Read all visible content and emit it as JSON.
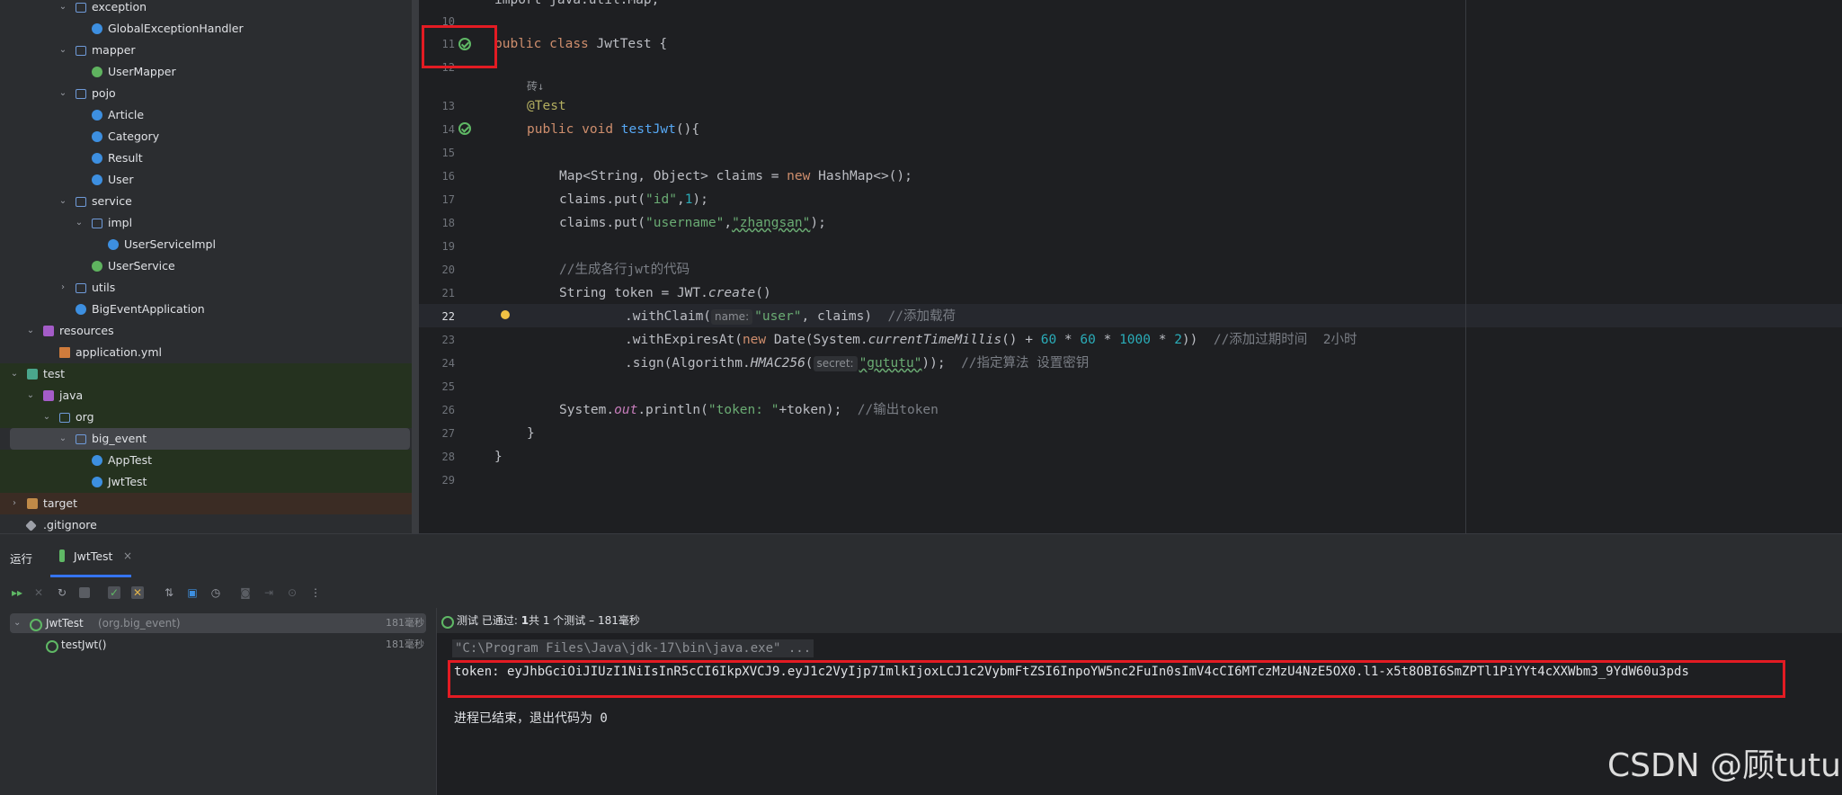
{
  "project_tree": [
    {
      "label": "exception",
      "icon": "package-folder-icon",
      "depth": 4,
      "expanded": true
    },
    {
      "label": "GlobalExceptionHandler",
      "icon": "class-icon",
      "depth": 5
    },
    {
      "label": "mapper",
      "icon": "package-folder-icon",
      "depth": 4,
      "expanded": true
    },
    {
      "label": "UserMapper",
      "icon": "interface-icon",
      "depth": 5
    },
    {
      "label": "pojo",
      "icon": "package-folder-icon",
      "depth": 4,
      "expanded": true
    },
    {
      "label": "Article",
      "icon": "class-icon",
      "depth": 5
    },
    {
      "label": "Category",
      "icon": "class-icon",
      "depth": 5
    },
    {
      "label": "Result",
      "icon": "class-icon",
      "depth": 5
    },
    {
      "label": "User",
      "icon": "class-icon",
      "depth": 5
    },
    {
      "label": "service",
      "icon": "package-folder-icon",
      "depth": 4,
      "expanded": true
    },
    {
      "label": "impl",
      "icon": "package-folder-icon",
      "depth": 5,
      "expanded": true
    },
    {
      "label": "UserServiceImpl",
      "icon": "class-icon",
      "depth": 6
    },
    {
      "label": "UserService",
      "icon": "interface-icon",
      "depth": 5
    },
    {
      "label": "utils",
      "icon": "package-folder-icon",
      "depth": 4,
      "expanded": false
    },
    {
      "label": "BigEventApplication",
      "icon": "class-icon",
      "depth": 4
    },
    {
      "label": "resources",
      "icon": "resources-folder-icon",
      "depth": 2,
      "expanded": true
    },
    {
      "label": "application.yml",
      "icon": "yml-file-icon",
      "depth": 3
    },
    {
      "label": "test",
      "icon": "test-folder-icon",
      "depth": 1,
      "expanded": true,
      "style": "green"
    },
    {
      "label": "java",
      "icon": "test-source-folder-icon",
      "depth": 2,
      "expanded": true,
      "style": "green"
    },
    {
      "label": "org",
      "icon": "package-folder-icon",
      "depth": 3,
      "expanded": true,
      "style": "green"
    },
    {
      "label": "big_event",
      "icon": "package-folder-icon",
      "depth": 4,
      "expanded": true,
      "style": "selected"
    },
    {
      "label": "AppTest",
      "icon": "test-class-icon",
      "depth": 5,
      "style": "green"
    },
    {
      "label": "JwtTest",
      "icon": "test-class-icon",
      "depth": 5,
      "style": "green"
    },
    {
      "label": "target",
      "icon": "target-folder-icon",
      "depth": 1,
      "expanded": false,
      "style": "orange"
    },
    {
      "label": ".gitignore",
      "icon": "git-file-icon",
      "depth": 1
    }
  ],
  "editor": {
    "line_numbers": [
      "10",
      "11",
      "12",
      "",
      "13",
      "14",
      "15",
      "16",
      "17",
      "18",
      "19",
      "20",
      "21",
      "22",
      "23",
      "24",
      "25",
      "26",
      "27",
      "28",
      "29"
    ],
    "top_cut_line": "import java.util.Map;",
    "author_hint": "砖↓",
    "code": {
      "l11_kw1": "public",
      "l11_kw2": "class",
      "l11_rest": " JwtTest {",
      "l13": "@Test",
      "l14_kw1": "public",
      "l14_kw2": "void",
      "l14_fn": "testJwt",
      "l14_rest": "(){",
      "l16_a": "Map<String, Object> claims = ",
      "l16_kw": "new",
      "l16_b": " HashMap<>();",
      "l17_a": "claims.put(",
      "l17_s": "\"id\"",
      "l17_c": ",",
      "l17_n": "1",
      "l17_d": ");",
      "l18_a": "claims.put(",
      "l18_s1": "\"username\"",
      "l18_c": ",",
      "l18_s2": "\"zhangsan\"",
      "l18_d": ");",
      "l20": "//生成各行jwt的代码",
      "l21_a": "String token = JWT.",
      "l21_it": "create",
      "l21_b": "()",
      "l22_a": ".withClaim(",
      "l22_hint": "name:",
      "l22_s": "\"user\"",
      "l22_b": ", claims)  ",
      "l22_cm": "//添加载荷",
      "l23_a": ".withExpiresAt(",
      "l23_kw": "new",
      "l23_b": " Date(System.",
      "l23_it": "currentTimeMillis",
      "l23_c": "() + ",
      "l23_n1": "60",
      "l23_op1": " * ",
      "l23_n2": "60",
      "l23_op2": " * ",
      "l23_n3": "1000",
      "l23_op3": " * ",
      "l23_n4": "2",
      "l23_d": "))  ",
      "l23_cm": "//添加过期时间  2小时",
      "l24_a": ".sign(Algorithm.",
      "l24_it": "HMAC256",
      "l24_b": "(",
      "l24_hint": "secret:",
      "l24_s": "\"gututu\"",
      "l24_c": "));  ",
      "l24_cm": "//指定算法 设置密钥",
      "l26_a": "System.",
      "l26_st": "out",
      "l26_b": ".println(",
      "l26_s": "\"token: \"",
      "l26_c": "+token);  ",
      "l26_cm": "//输出token",
      "l27": "}",
      "l28": "}"
    }
  },
  "run_panel": {
    "title": "运行",
    "tab_label": "JwtTest",
    "tests": [
      {
        "name": "JwtTest",
        "pkg": "(org.big_event)",
        "time": "181毫秒"
      },
      {
        "name": "testJwt()",
        "time": "181毫秒"
      }
    ],
    "status_prefix": "测试 已通过: ",
    "status_count": "1",
    "status_suffix": "共 1 个测试 – 181毫秒",
    "console": {
      "cmd": "\"C:\\Program Files\\Java\\jdk-17\\bin\\java.exe\" ...",
      "token": "token: eyJhbGciOiJIUzI1NiIsInR5cCI6IkpXVCJ9.eyJ1c2VyIjp7ImlkIjoxLCJ1c2VybmFtZSI6InpoYW5nc2FuIn0sImV4cCI6MTczMzU4NzE5OX0.l1-x5t8OBI6SmZPTl1PiYYt4cXXWbm3_9YdW60u3pds",
      "exit": "进程已结束，退出代码为 0"
    }
  },
  "watermark": "CSDN @顾tutu",
  "colors": {
    "highlight_box": "#e31b23",
    "pass_green": "#5fb865",
    "keyword": "#cf8e6d",
    "string": "#6aab73",
    "number": "#2aacb8"
  }
}
